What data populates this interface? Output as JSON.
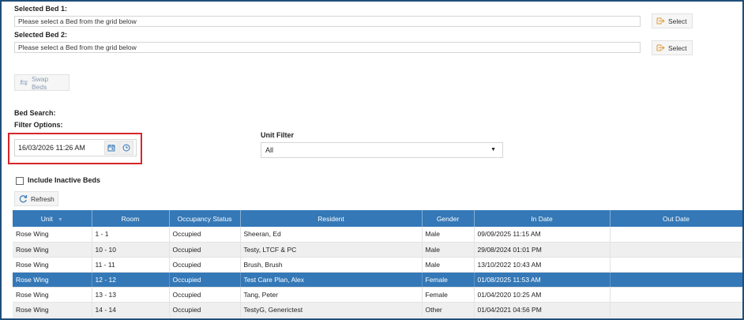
{
  "bed_selection": {
    "bed1_label": "Selected Bed 1:",
    "bed1_value": "Please select a Bed from the grid below",
    "bed2_label": "Selected Bed 2:",
    "bed2_value": "Please select a Bed from the grid below",
    "select_label": "Select",
    "swap_label": "Swap Beds"
  },
  "search": {
    "bed_search_label": "Bed Search:",
    "filter_options_label": "Filter Options:",
    "datetime_value": "16/03/2026 11:26 AM",
    "unit_filter_label": "Unit Filter",
    "unit_filter_value": "All",
    "include_inactive_label": "Include Inactive Beds",
    "refresh_label": "Refresh"
  },
  "grid": {
    "columns": [
      "Unit",
      "Room",
      "Occupancy Status",
      "Resident",
      "Gender",
      "In Date",
      "Out Date"
    ],
    "rows": [
      {
        "unit": "Rose Wing",
        "room": "1 - 1",
        "status": "Occupied",
        "resident": "Sheeran, Ed",
        "gender": "Male",
        "in_date": "09/09/2025 11:15 AM",
        "out_date": ""
      },
      {
        "unit": "Rose Wing",
        "room": "10 - 10",
        "status": "Occupied",
        "resident": "Testy, LTCF & PC",
        "gender": "Male",
        "in_date": "29/08/2024 01:01 PM",
        "out_date": ""
      },
      {
        "unit": "Rose Wing",
        "room": "11 - 11",
        "status": "Occupied",
        "resident": "Brush, Brush",
        "gender": "Male",
        "in_date": "13/10/2022 10:43 AM",
        "out_date": ""
      },
      {
        "unit": "Rose Wing",
        "room": "12 - 12",
        "status": "Occupied",
        "resident": "Test Care Plan, Alex",
        "gender": "Female",
        "in_date": "01/08/2025 11:53 AM",
        "out_date": ""
      },
      {
        "unit": "Rose Wing",
        "room": "13 - 13",
        "status": "Occupied",
        "resident": "Tang, Peter",
        "gender": "Female",
        "in_date": "01/04/2020 10:25 AM",
        "out_date": ""
      },
      {
        "unit": "Rose Wing",
        "room": "14 - 14",
        "status": "Occupied",
        "resident": "TestyG, Generictest",
        "gender": "Other",
        "in_date": "01/04/2021 04:56 PM",
        "out_date": ""
      }
    ]
  },
  "colors": {
    "header": "#3478b7",
    "selected_row": "#3478b7",
    "highlight_box": "#d7262b",
    "frame": "#1f4e79"
  }
}
